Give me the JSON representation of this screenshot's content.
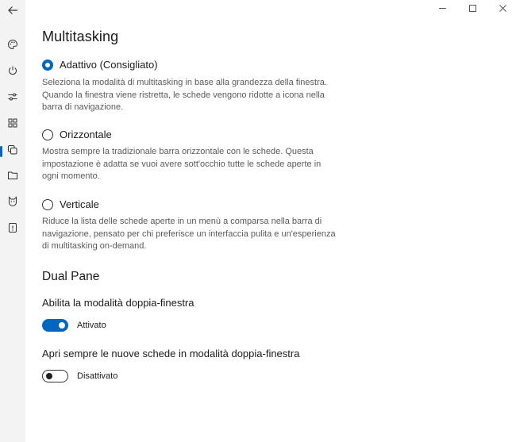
{
  "sidebar": {
    "items": [
      {
        "icon": "back-arrow-icon"
      },
      {
        "icon": "palette-icon"
      },
      {
        "icon": "power-icon"
      },
      {
        "icon": "sliders-icon"
      },
      {
        "icon": "widgets-icon"
      },
      {
        "icon": "multitasking-icon",
        "selected": true
      },
      {
        "icon": "folder-icon"
      },
      {
        "icon": "cat-icon"
      },
      {
        "icon": "about-icon"
      }
    ]
  },
  "window_controls": [
    "minimize-icon",
    "maximize-icon",
    "close-icon"
  ],
  "main": {
    "title": "Multitasking",
    "options": [
      {
        "label": "Adattivo (Consigliato)",
        "checked": true,
        "description": "Seleziona la modalità di multitasking in base alla grandezza della finestra. Quando la finestra viene ristretta, le schede vengono ridotte a icona nella barra di navigazione."
      },
      {
        "label": "Orizzontale",
        "checked": false,
        "description": "Mostra sempre la tradizionale barra orizzontale con le schede. Questa impostazione è adatta se vuoi avere sott'occhio tutte le schede aperte in ogni momento."
      },
      {
        "label": "Verticale",
        "checked": false,
        "description": "Riduce la lista delle schede aperte in un menù a comparsa nella barra di navigazione, pensato per chi preferisce un interfaccia pulita e un'esperienza di multitasking on-demand."
      }
    ],
    "dual_pane": {
      "title": "Dual Pane",
      "setting1": {
        "label": "Abilita la modalità doppia-finestra",
        "state": "Attivato",
        "on": true
      },
      "setting2": {
        "label": "Apri sempre le nuove schede in modalità doppia-finestra",
        "state": "Disattivato",
        "on": false
      }
    }
  },
  "colors": {
    "accent": "#0067c0",
    "sidebar_bg": "#f3f3f3",
    "description_text": "#5a5a5a"
  }
}
